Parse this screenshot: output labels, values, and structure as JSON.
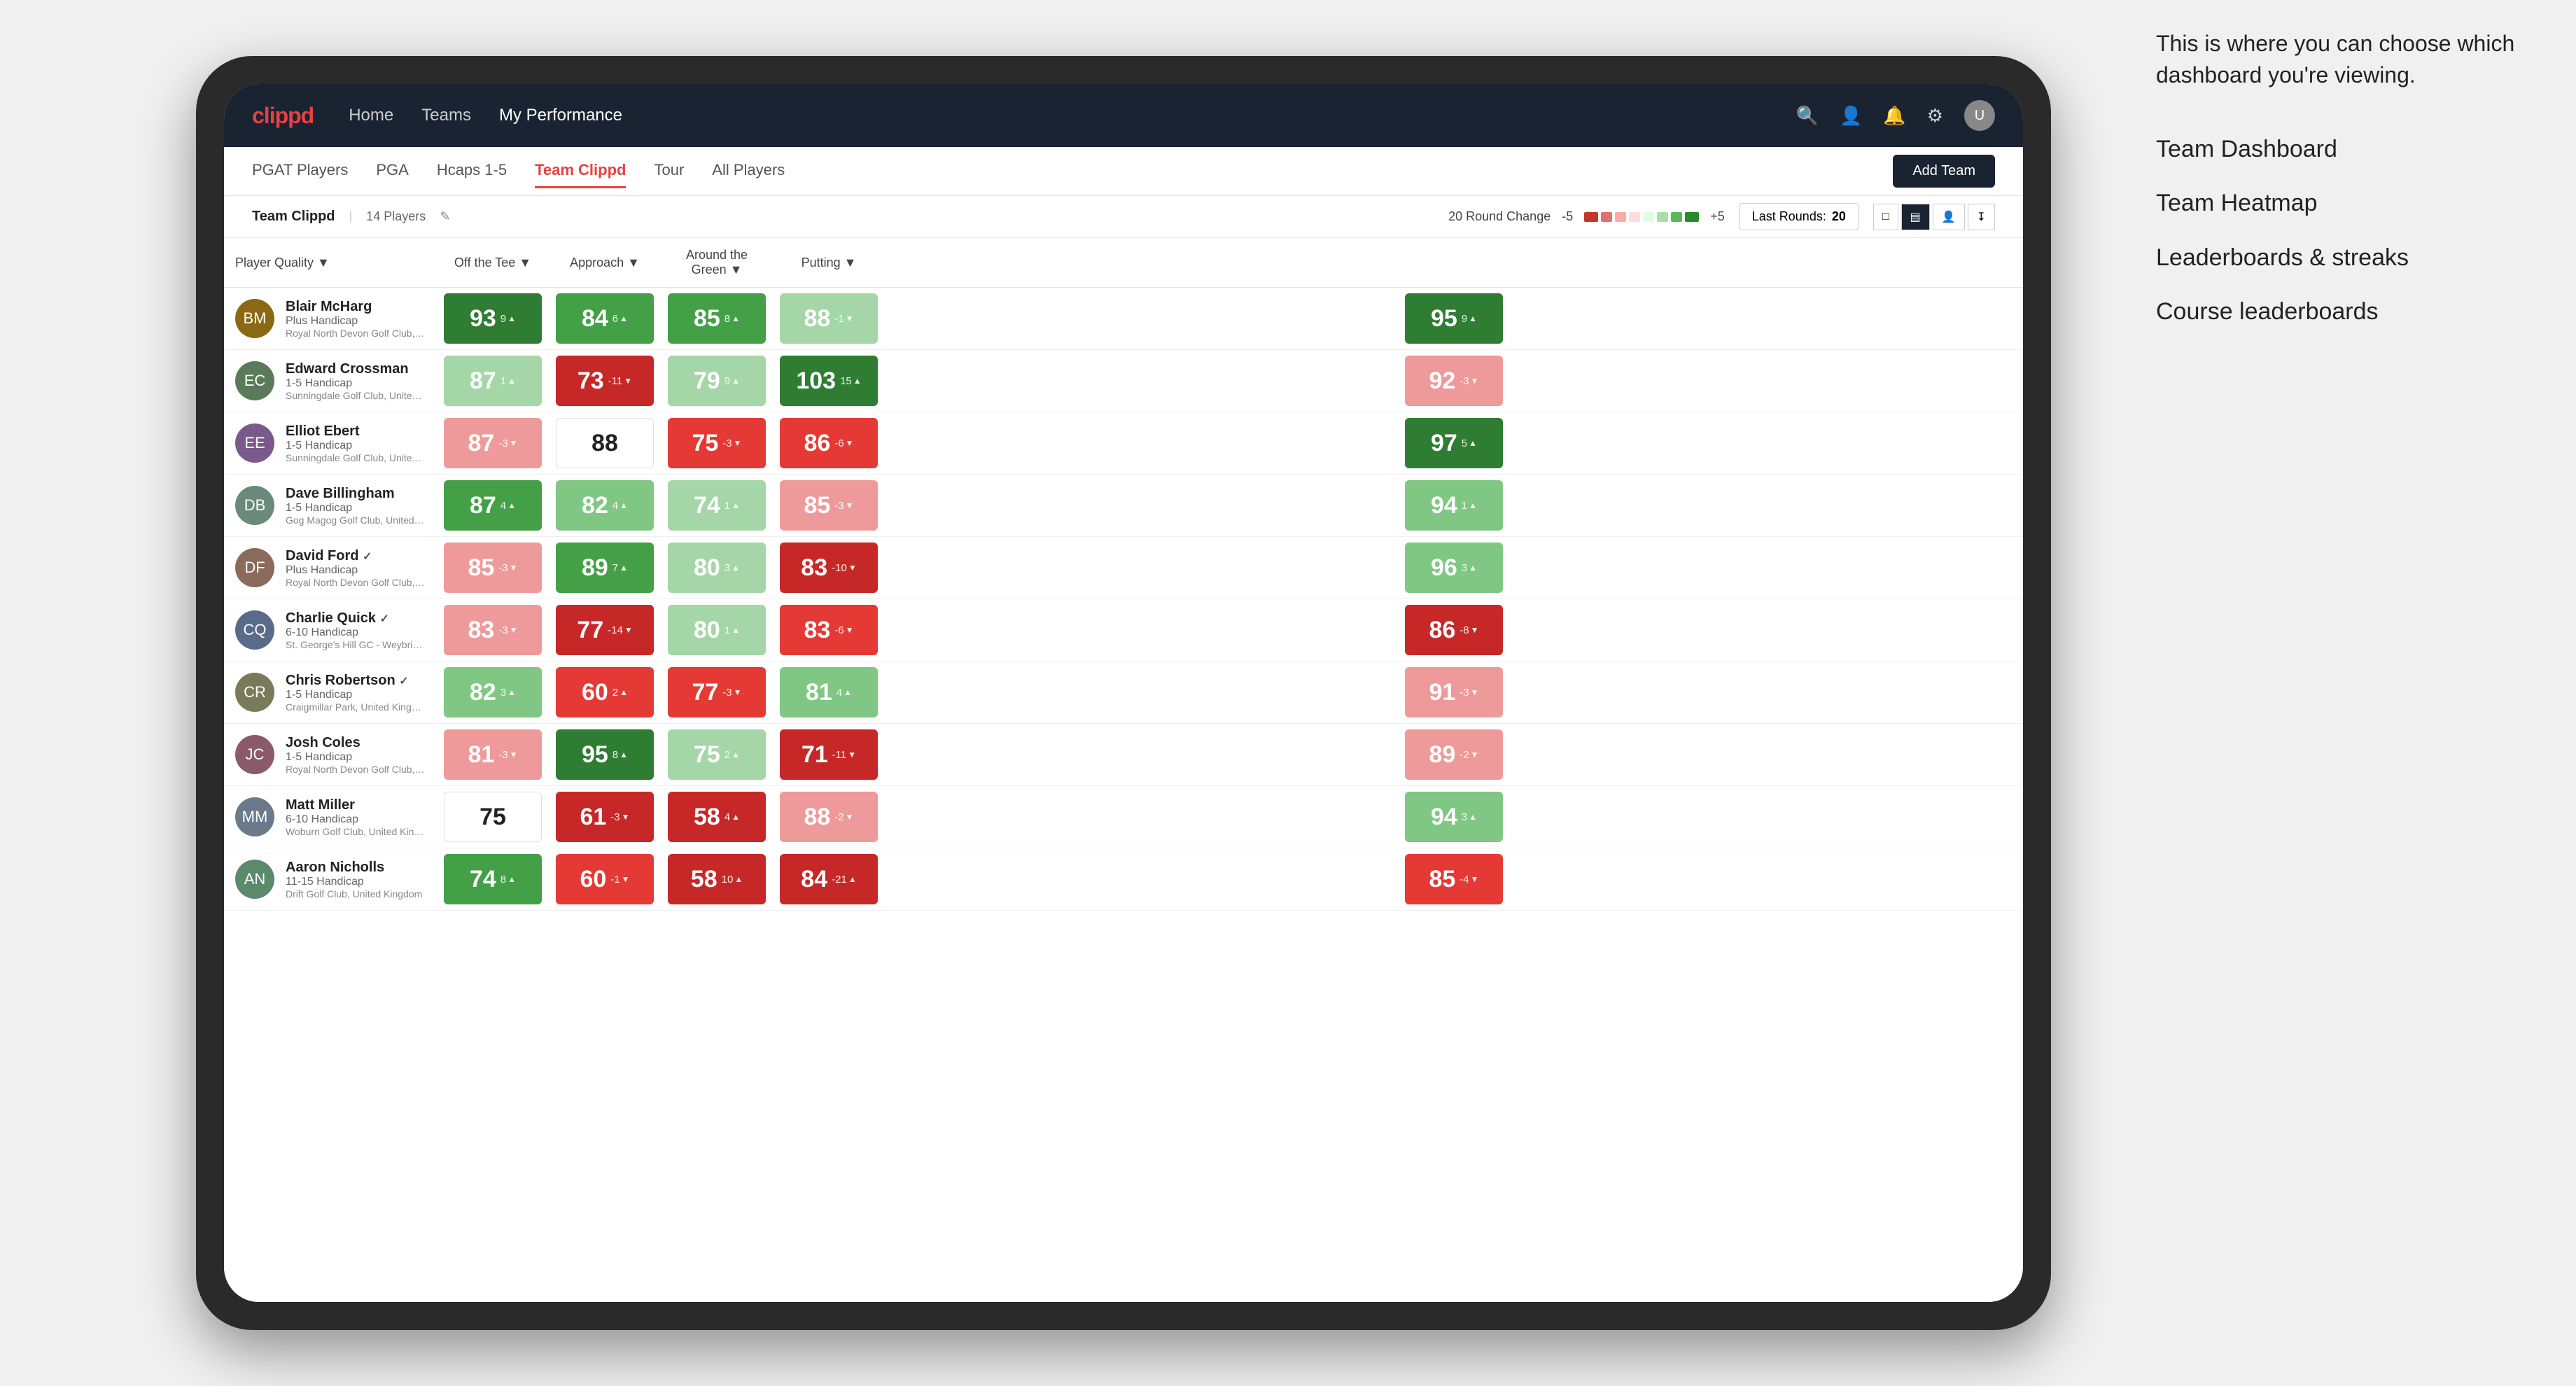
{
  "annotation": {
    "intro": "This is where you can choose which dashboard you're viewing.",
    "items": [
      "Team Dashboard",
      "Team Heatmap",
      "Leaderboards & streaks",
      "Course leaderboards"
    ]
  },
  "nav": {
    "logo": "clippd",
    "links": [
      "Home",
      "Teams",
      "My Performance"
    ],
    "active_link": "My Performance"
  },
  "secondary_nav": {
    "items": [
      "PGAT Players",
      "PGA",
      "Hcaps 1-5",
      "Team Clippd",
      "Tour",
      "All Players"
    ],
    "active": "Team Clippd",
    "add_team_label": "Add Team"
  },
  "team_bar": {
    "name": "Team Clippd",
    "separator": "|",
    "count": "14 Players",
    "round_change_label": "20 Round Change",
    "low_val": "-5",
    "high_val": "+5",
    "last_rounds_label": "Last Rounds:",
    "last_rounds_val": "20"
  },
  "table": {
    "columns": [
      "Player Quality ▼",
      "Off the Tee ▼",
      "Approach ▼",
      "Around the Green ▼",
      "Putting ▼"
    ],
    "rows": [
      {
        "name": "Blair McHarg",
        "badge": "",
        "handicap": "Plus Handicap",
        "club": "Royal North Devon Golf Club, United Kingdom",
        "scores": [
          {
            "val": "93",
            "delta": "9▲",
            "color": "bg-green-dark"
          },
          {
            "val": "84",
            "delta": "6▲",
            "color": "bg-green-mid"
          },
          {
            "val": "85",
            "delta": "8▲",
            "color": "bg-green-mid"
          },
          {
            "val": "88",
            "delta": "-1▼",
            "color": "bg-light-green"
          },
          {
            "val": "95",
            "delta": "9▲",
            "color": "bg-green-dark"
          }
        ]
      },
      {
        "name": "Edward Crossman",
        "badge": "",
        "handicap": "1-5 Handicap",
        "club": "Sunningdale Golf Club, United Kingdom",
        "scores": [
          {
            "val": "87",
            "delta": "1▲",
            "color": "bg-light-green"
          },
          {
            "val": "73",
            "delta": "-11▼",
            "color": "bg-red-dark"
          },
          {
            "val": "79",
            "delta": "9▲",
            "color": "bg-light-green"
          },
          {
            "val": "103",
            "delta": "15▲",
            "color": "bg-green-dark"
          },
          {
            "val": "92",
            "delta": "-3▼",
            "color": "bg-light-red"
          }
        ]
      },
      {
        "name": "Elliot Ebert",
        "badge": "",
        "handicap": "1-5 Handicap",
        "club": "Sunningdale Golf Club, United Kingdom",
        "scores": [
          {
            "val": "87",
            "delta": "-3▼",
            "color": "bg-light-red"
          },
          {
            "val": "88",
            "delta": "",
            "color": "bg-white"
          },
          {
            "val": "75",
            "delta": "-3▼",
            "color": "bg-red-mid"
          },
          {
            "val": "86",
            "delta": "-6▼",
            "color": "bg-red-mid"
          },
          {
            "val": "97",
            "delta": "5▲",
            "color": "bg-green-dark"
          }
        ]
      },
      {
        "name": "Dave Billingham",
        "badge": "",
        "handicap": "1-5 Handicap",
        "club": "Gog Magog Golf Club, United Kingdom",
        "scores": [
          {
            "val": "87",
            "delta": "4▲",
            "color": "bg-green-mid"
          },
          {
            "val": "82",
            "delta": "4▲",
            "color": "bg-green-light"
          },
          {
            "val": "74",
            "delta": "1▲",
            "color": "bg-light-green"
          },
          {
            "val": "85",
            "delta": "-3▼",
            "color": "bg-light-red"
          },
          {
            "val": "94",
            "delta": "1▲",
            "color": "bg-green-light"
          }
        ]
      },
      {
        "name": "David Ford",
        "badge": "✓",
        "handicap": "Plus Handicap",
        "club": "Royal North Devon Golf Club, United Kingdom",
        "scores": [
          {
            "val": "85",
            "delta": "-3▼",
            "color": "bg-light-red"
          },
          {
            "val": "89",
            "delta": "7▲",
            "color": "bg-green-mid"
          },
          {
            "val": "80",
            "delta": "3▲",
            "color": "bg-light-green"
          },
          {
            "val": "83",
            "delta": "-10▼",
            "color": "bg-red-dark"
          },
          {
            "val": "96",
            "delta": "3▲",
            "color": "bg-green-light"
          }
        ]
      },
      {
        "name": "Charlie Quick",
        "badge": "✓",
        "handicap": "6-10 Handicap",
        "club": "St. George's Hill GC - Weybridge - Surrey, Uni...",
        "scores": [
          {
            "val": "83",
            "delta": "-3▼",
            "color": "bg-light-red"
          },
          {
            "val": "77",
            "delta": "-14▼",
            "color": "bg-red-dark"
          },
          {
            "val": "80",
            "delta": "1▲",
            "color": "bg-light-green"
          },
          {
            "val": "83",
            "delta": "-6▼",
            "color": "bg-red-mid"
          },
          {
            "val": "86",
            "delta": "-8▼",
            "color": "bg-red-dark"
          }
        ]
      },
      {
        "name": "Chris Robertson",
        "badge": "✓",
        "handicap": "1-5 Handicap",
        "club": "Craigmillar Park, United Kingdom",
        "scores": [
          {
            "val": "82",
            "delta": "3▲",
            "color": "bg-green-light"
          },
          {
            "val": "60",
            "delta": "2▲",
            "color": "bg-red-mid"
          },
          {
            "val": "77",
            "delta": "-3▼",
            "color": "bg-red-mid"
          },
          {
            "val": "81",
            "delta": "4▲",
            "color": "bg-green-light"
          },
          {
            "val": "91",
            "delta": "-3▼",
            "color": "bg-light-red"
          }
        ]
      },
      {
        "name": "Josh Coles",
        "badge": "",
        "handicap": "1-5 Handicap",
        "club": "Royal North Devon Golf Club, United Kingdom",
        "scores": [
          {
            "val": "81",
            "delta": "-3▼",
            "color": "bg-light-red"
          },
          {
            "val": "95",
            "delta": "8▲",
            "color": "bg-green-dark"
          },
          {
            "val": "75",
            "delta": "2▲",
            "color": "bg-light-green"
          },
          {
            "val": "71",
            "delta": "-11▼",
            "color": "bg-red-dark"
          },
          {
            "val": "89",
            "delta": "-2▼",
            "color": "bg-light-red"
          }
        ]
      },
      {
        "name": "Matt Miller",
        "badge": "",
        "handicap": "6-10 Handicap",
        "club": "Woburn Golf Club, United Kingdom",
        "scores": [
          {
            "val": "75",
            "delta": "",
            "color": "bg-white"
          },
          {
            "val": "61",
            "delta": "-3▼",
            "color": "bg-red-dark"
          },
          {
            "val": "58",
            "delta": "4▲",
            "color": "bg-red-dark"
          },
          {
            "val": "88",
            "delta": "-2▼",
            "color": "bg-light-red"
          },
          {
            "val": "94",
            "delta": "3▲",
            "color": "bg-green-light"
          }
        ]
      },
      {
        "name": "Aaron Nicholls",
        "badge": "",
        "handicap": "11-15 Handicap",
        "club": "Drift Golf Club, United Kingdom",
        "scores": [
          {
            "val": "74",
            "delta": "8▲",
            "color": "bg-green-mid"
          },
          {
            "val": "60",
            "delta": "-1▼",
            "color": "bg-red-mid"
          },
          {
            "val": "58",
            "delta": "10▲",
            "color": "bg-red-dark"
          },
          {
            "val": "84",
            "delta": "-21▲",
            "color": "bg-red-dark"
          },
          {
            "val": "85",
            "delta": "-4▼",
            "color": "bg-red-mid"
          }
        ]
      }
    ]
  }
}
